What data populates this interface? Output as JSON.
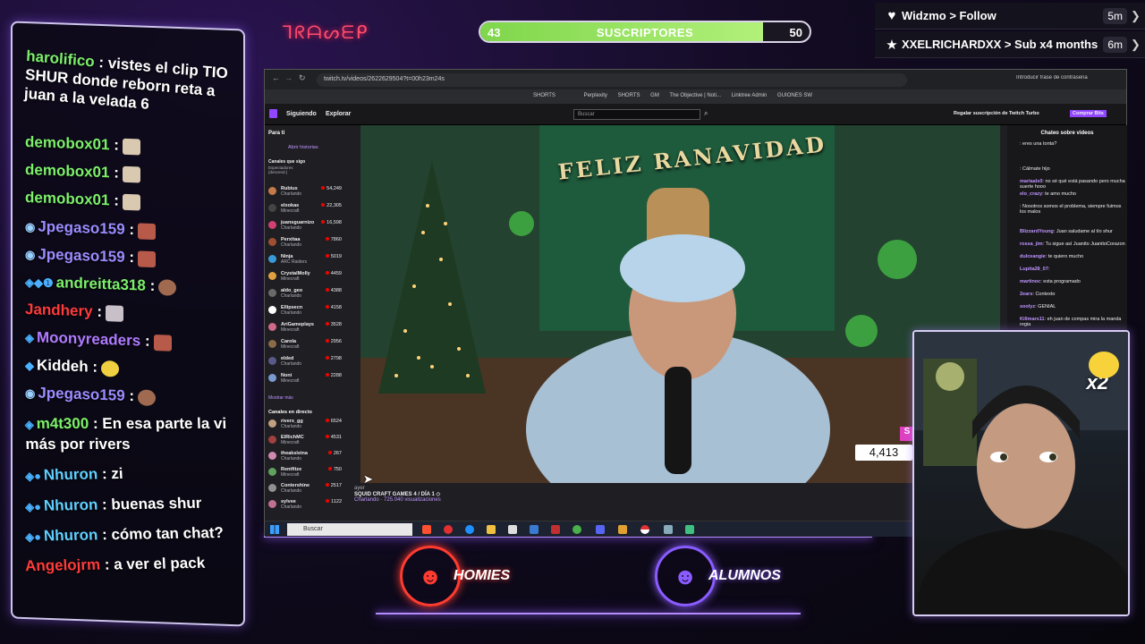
{
  "overlay": {
    "neon_sign": "ᒣᖇᗩᔕᗴᑭ",
    "sub_goal": {
      "label": "SUSCRIPTORES",
      "current": "43",
      "goal": "50",
      "progress": 0.86
    },
    "alerts": [
      {
        "icon": "heart-icon",
        "text": "Widzmo > Follow",
        "time": "5m"
      },
      {
        "icon": "star-icon",
        "text": "XXELRICHARDXX > Sub x4 months",
        "time": "6m"
      }
    ],
    "viewer_count": "4,413",
    "viewer_badge": "S",
    "logos": [
      {
        "label": "HOMIES",
        "color": "#ff3b30"
      },
      {
        "label": "ALUMNOS",
        "color": "#8a5cff"
      }
    ],
    "webcam_badge": "x2"
  },
  "chat": [
    {
      "user": "harolifico",
      "color": "#7cf06a",
      "msg": ": vistes el clip TIO SHUR donde reborn reta a juan a la velada 6",
      "badges": ""
    },
    {
      "user": "demobox01",
      "color": "#7cf06a",
      "msg": ":",
      "badges": ""
    },
    {
      "user": "demobox01",
      "color": "#7cf06a",
      "msg": ":",
      "badges": ""
    },
    {
      "user": "demobox01",
      "color": "#7cf06a",
      "msg": ":",
      "badges": ""
    },
    {
      "user": "Jpegaso159",
      "color": "#9b8cff",
      "msg": ":",
      "badges": "◉"
    },
    {
      "user": "Jpegaso159",
      "color": "#9b8cff",
      "msg": ":",
      "badges": "◉"
    },
    {
      "user": "andreitta318",
      "color": "#7cf06a",
      "msg": ":",
      "badges": "◈◆❶"
    },
    {
      "user": "Jandhery",
      "color": "#ff3b3b",
      "msg": ":",
      "badges": ""
    },
    {
      "user": "Moonyreaders",
      "color": "#b07cff",
      "msg": ":",
      "badges": "◈"
    },
    {
      "user": "Kiddeh",
      "color": "#ffffff",
      "msg": ":",
      "badges": "◆"
    },
    {
      "user": "Jpegaso159",
      "color": "#9b8cff",
      "msg": ":",
      "badges": "◉"
    },
    {
      "user": "m4t300",
      "color": "#7cf06a",
      "msg": ": En esa parte la vi más por rivers",
      "badges": "◈"
    },
    {
      "user": "Nhuron",
      "color": "#5fd0ff",
      "msg": ": zi",
      "badges": "◈●"
    },
    {
      "user": "Nhuron",
      "color": "#5fd0ff",
      "msg": ": buenas shur",
      "badges": "◈●"
    },
    {
      "user": "Nhuron",
      "color": "#5fd0ff",
      "msg": ": cómo tan chat?",
      "badges": "◈●"
    },
    {
      "user": "Angelojrm",
      "color": "#ff3b3b",
      "msg": ": a ver el pack",
      "badges": ""
    }
  ],
  "browser": {
    "url": "twitch.tv/videos/2622629504?t=00h23m24s",
    "password_hint": "Introducir frase de contraseña",
    "bookmarks": [
      "SHORTS",
      "Perplexity",
      "SHORTS",
      "GM",
      "The Objective | Noti...",
      "Linktree Admin",
      "GUIONES SW"
    ],
    "nav": {
      "following": "Siguiendo",
      "browse": "Explorar",
      "search_placeholder": "Buscar",
      "turbo": "Regalar suscripción de Twitch Turbo",
      "bits": "Comprar Bits"
    },
    "sidebar_title": "Para ti",
    "stories": "Abrir historias",
    "followed_header": "Canales que sigo",
    "followed_sub": "Espectadores (descend.)",
    "show_more": "Mostrar más",
    "live_header": "Canales en directo",
    "channels": [
      {
        "name": "Rubius",
        "game": "Charlando",
        "viewers": "54,249",
        "color": "#c47a4a"
      },
      {
        "name": "elxokas",
        "game": "Minecraft",
        "viewers": "22,305",
        "color": "#444"
      },
      {
        "name": "juansguarnizo",
        "game": "Charlando",
        "viewers": "16,598",
        "color": "#d04070"
      },
      {
        "name": "Perxitaa",
        "game": "Charlando",
        "viewers": "7860",
        "color": "#a05030"
      },
      {
        "name": "Ninja",
        "game": "ARC Raiders",
        "viewers": "5019",
        "color": "#3a9ad9"
      },
      {
        "name": "CrystalMolly",
        "game": "Minecraft",
        "viewers": "4459",
        "color": "#e0a040"
      },
      {
        "name": "aldo_geo",
        "game": "Charlando",
        "viewers": "4388",
        "color": "#6a6a6a"
      },
      {
        "name": "Ellipsecn",
        "game": "Charlando",
        "viewers": "4158",
        "color": "#fff"
      },
      {
        "name": "AriGameplays",
        "game": "Minecraft",
        "viewers": "3528",
        "color": "#d06a8a"
      },
      {
        "name": "Carola",
        "game": "Minecraft",
        "viewers": "2956",
        "color": "#8a6a4a"
      },
      {
        "name": "elded",
        "game": "Charlando",
        "viewers": "2798",
        "color": "#5a5a8a"
      },
      {
        "name": "Noni",
        "game": "Minecraft",
        "viewers": "2288",
        "color": "#7a9ad0"
      }
    ],
    "live_channels": [
      {
        "name": "rivers_gg",
        "game": "Charlando",
        "viewers": "6524",
        "color": "#c0a080"
      },
      {
        "name": "ElRichMC",
        "game": "Minecraft",
        "viewers": "4531",
        "color": "#a04040"
      },
      {
        "name": "theaksleina",
        "game": "Charlando",
        "viewers": "267",
        "color": "#d08ab0"
      },
      {
        "name": "Rentfitze",
        "game": "Minecraft",
        "viewers": "750",
        "color": "#60a060"
      },
      {
        "name": "Contershine",
        "game": "Charlando",
        "viewers": "2517",
        "color": "#909090"
      },
      {
        "name": "sylvee",
        "game": "Charlando",
        "viewers": "1122",
        "color": "#c07090"
      }
    ],
    "video": {
      "sign": "FELIZ RANAVIDAD",
      "author": "ayer",
      "title": "SQUID CRAFT GAMES 4 / DÍA 1 ◇",
      "meta": "Charlando · 725.040 visualizaciones"
    },
    "right_chat_title": "Chateo sobre videos",
    "right_chat": [
      {
        "user": "",
        "msg": ": eres una tonta?"
      },
      {
        "user": "",
        "msg": ""
      },
      {
        "user": "",
        "msg": ": Cálmate hijo"
      },
      {
        "user": "mariaals0",
        "msg": ": no sé qué está pasando pero mucha suerte hooo"
      },
      {
        "user": "elo_crazy",
        "msg": ": te amo mucho"
      },
      {
        "user": "",
        "msg": ": Nosotros somos el problema, siempre fuimos los malos"
      },
      {
        "user": "",
        "msg": ""
      },
      {
        "user": "BlizzardYoung",
        "msg": ": Juan saludame al tío shur"
      },
      {
        "user": "rossa_jim",
        "msg": ": Tu sigue así Juanito JuanitoCorazon"
      },
      {
        "user": "dulceangie",
        "msg": ": te quiero mucho"
      },
      {
        "user": "Lupita28_07",
        "msg": ":"
      },
      {
        "user": "martinoc",
        "msg": ": esta programado"
      },
      {
        "user": "2ears",
        "msg": ": Contexto"
      },
      {
        "user": "soolyz",
        "msg": ": GENIAL"
      },
      {
        "user": "Killmars11",
        "msg": ": eh juan de compas mira la manda regia"
      }
    ],
    "taskbar_search": "Buscar"
  }
}
